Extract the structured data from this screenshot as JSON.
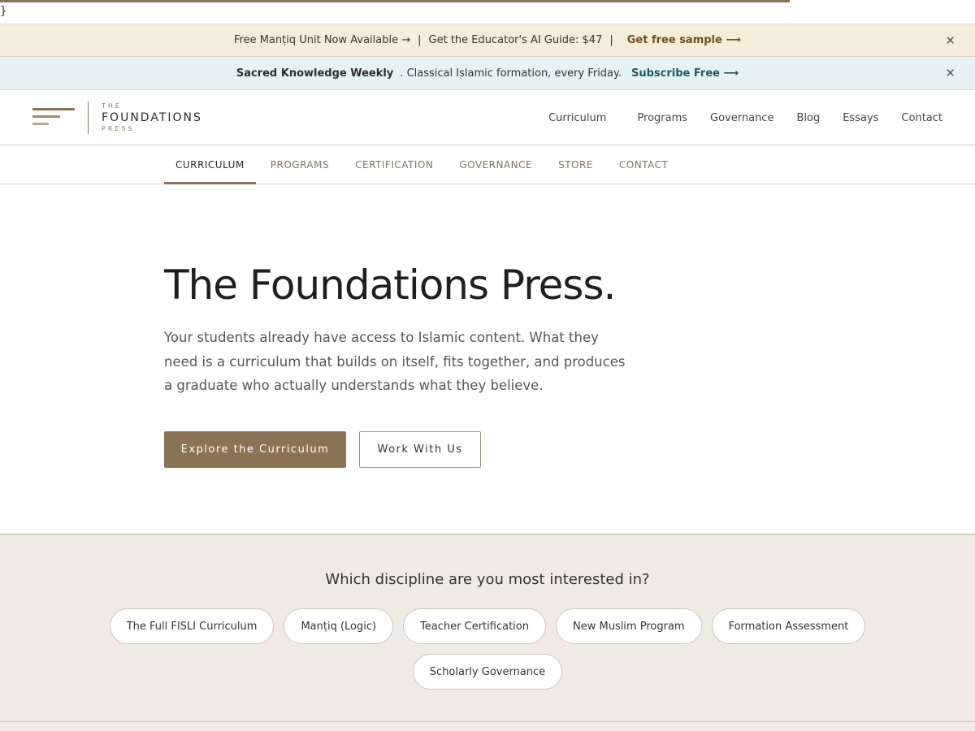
{
  "scroll_progress_percent": 81,
  "stray_text": "}",
  "announcement": {
    "part1": "Free Manṭiq Unit Now Available →",
    "separator": "|",
    "part2": "Get the Educator's AI Guide: $47",
    "cta": "Get free sample ⟶",
    "close": "✕"
  },
  "newsletter": {
    "title": "Sacred Knowledge Weekly",
    "text": ". Classical Islamic formation, every Friday.",
    "cta": "Subscribe Free ⟶",
    "close": "✕"
  },
  "logo": {
    "the": "THE",
    "main": "FOUNDATIONS",
    "press": "PRESS"
  },
  "top_nav": [
    "Curriculum",
    "Programs",
    "Governance",
    "Blog",
    "Essays",
    "Contact"
  ],
  "sub_nav": {
    "items": [
      "CURRICULUM",
      "PROGRAMS",
      "CERTIFICATION",
      "GOVERNANCE",
      "STORE",
      "CONTACT"
    ],
    "active": "CURRICULUM"
  },
  "hero": {
    "title": "The Foundations Press.",
    "description": "Your students already have access to Islamic content. What they need is a curriculum that builds on itself, fits together, and produces a graduate who actually understands what they believe.",
    "primary_button": "Explore the Curriculum",
    "secondary_button": "Work With Us"
  },
  "discipline": {
    "question": "Which discipline are you most interested in?",
    "options_row1": [
      "The Full FISLI Curriculum",
      "Manṭiq (Logic)",
      "Teacher Certification",
      "New Muslim Program",
      "Formation Assessment"
    ],
    "options_row2": [
      "Scholarly Governance"
    ]
  },
  "colors": {
    "accent": "#8b7355",
    "announcement_bg": "#f5ecda",
    "newsletter_bg": "#e6f2f3",
    "newsletter_cta": "#1e5b5e",
    "discipline_bg": "#efebe4"
  }
}
